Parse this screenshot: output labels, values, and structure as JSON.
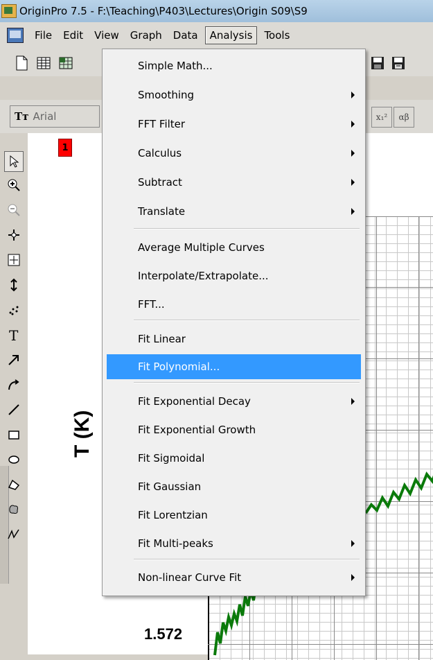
{
  "window": {
    "title": "OriginPro 7.5 - F:\\Teaching\\P403\\Lectures\\Origin S09\\S9"
  },
  "menubar": {
    "items": [
      "File",
      "Edit",
      "View",
      "Graph",
      "Data",
      "Analysis",
      "Tools"
    ],
    "active": "Analysis"
  },
  "format_toolbar": {
    "font": "Arial",
    "font_icon": "Tт",
    "superscript_button": "x₁²",
    "greek_button": "αβ"
  },
  "graph": {
    "layer_number": "1",
    "y_axis_label": "T (K)",
    "y_tick_label": "1.572"
  },
  "analysis_menu": {
    "items": [
      {
        "label": "Simple Math...",
        "submenu": false
      },
      {
        "label": "Smoothing",
        "submenu": true
      },
      {
        "label": "FFT Filter",
        "submenu": true
      },
      {
        "label": "Calculus",
        "submenu": true
      },
      {
        "label": "Subtract",
        "submenu": true
      },
      {
        "label": "Translate",
        "submenu": true
      },
      {
        "label": "Average Multiple Curves",
        "submenu": false
      },
      {
        "label": "Interpolate/Extrapolate...",
        "submenu": false
      },
      {
        "label": "FFT...",
        "submenu": false
      },
      {
        "label": "Fit Linear",
        "submenu": false
      },
      {
        "label": "Fit Polynomial...",
        "submenu": false,
        "highlighted": true
      },
      {
        "label": "Fit Exponential Decay",
        "submenu": true
      },
      {
        "label": "Fit Exponential Growth",
        "submenu": false
      },
      {
        "label": "Fit Sigmoidal",
        "submenu": false
      },
      {
        "label": "Fit Gaussian",
        "submenu": false
      },
      {
        "label": "Fit Lorentzian",
        "submenu": false
      },
      {
        "label": "Fit Multi-peaks",
        "submenu": true
      },
      {
        "label": "Non-linear Curve Fit",
        "submenu": true
      }
    ]
  },
  "colors": {
    "highlight": "#3399ff",
    "layer_tag": "#ff0000",
    "data_trace": "#0a7a0a"
  },
  "icons": {
    "toolbar": [
      "new-document-icon",
      "open-worksheet-icon",
      "open-excel-icon",
      "save-icon",
      "save-as-icon"
    ],
    "left_tools": [
      "pointer-icon",
      "zoom-in-icon",
      "zoom-out-icon",
      "screen-reader-icon",
      "data-reader-icon",
      "data-selector-icon",
      "draw-data-icon",
      "text-tool-icon",
      "arrow-tool-icon",
      "curved-arrow-icon",
      "line-tool-icon",
      "rectangle-tool-icon",
      "oval-tool-icon",
      "polygon-tool-icon",
      "region-tool-icon",
      "freehand-tool-icon"
    ]
  }
}
